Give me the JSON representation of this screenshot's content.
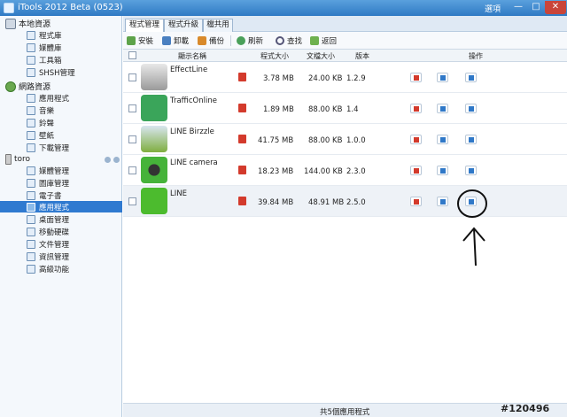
{
  "window": {
    "title": "iTools 2012 Beta (0523)",
    "options_label": "選項",
    "min": "—",
    "max": "□",
    "close": "✕"
  },
  "sidebar": {
    "local": {
      "label": "本地資源",
      "items": [
        "程式庫",
        "媒體庫",
        "工具箱",
        "SHSH管理"
      ]
    },
    "online": {
      "label": "網路資源",
      "items": [
        "應用程式",
        "音樂",
        "鈴聲",
        "壁紙",
        "下載管理"
      ]
    },
    "device": {
      "label": "toro",
      "items": [
        "媒體管理",
        "圖庫管理",
        "電子書",
        "應用程式",
        "桌面管理",
        "移動硬碟",
        "文件管理",
        "資訊管理",
        "高級功能"
      ]
    }
  },
  "tabs": [
    "程式管理",
    "程式升級",
    "檔共用"
  ],
  "toolbar": {
    "install": "安裝",
    "uninstall": "卸載",
    "backup": "備份",
    "refresh": "刷新",
    "search": "查找",
    "back": "返回"
  },
  "columns": {
    "name": "顯示名稱",
    "app_size": "程式大小",
    "doc_size": "文檔大小",
    "version": "版本",
    "actions": "操作"
  },
  "apps": [
    {
      "name": "EffectLine",
      "app_size": "3.78 MB",
      "doc_size": "24.00 KB",
      "version": "1.2.9"
    },
    {
      "name": "TrafficOnline",
      "app_size": "1.89 MB",
      "doc_size": "88.00 KB",
      "version": "1.4"
    },
    {
      "name": "LINE Birzzle",
      "app_size": "41.75 MB",
      "doc_size": "88.00 KB",
      "version": "1.0.0"
    },
    {
      "name": "LINE camera",
      "app_size": "18.23 MB",
      "doc_size": "144.00 KB",
      "version": "2.3.0"
    },
    {
      "name": "LINE",
      "app_size": "39.84 MB",
      "doc_size": "48.91 MB",
      "version": "2.5.0"
    }
  ],
  "status": "共5個應用程式",
  "watermark": "#120496",
  "colors": {
    "titlebar": "#3b86cf",
    "selection": "#2f7ad0",
    "delete": "#d33a2c",
    "folder": "#2f78c8"
  }
}
